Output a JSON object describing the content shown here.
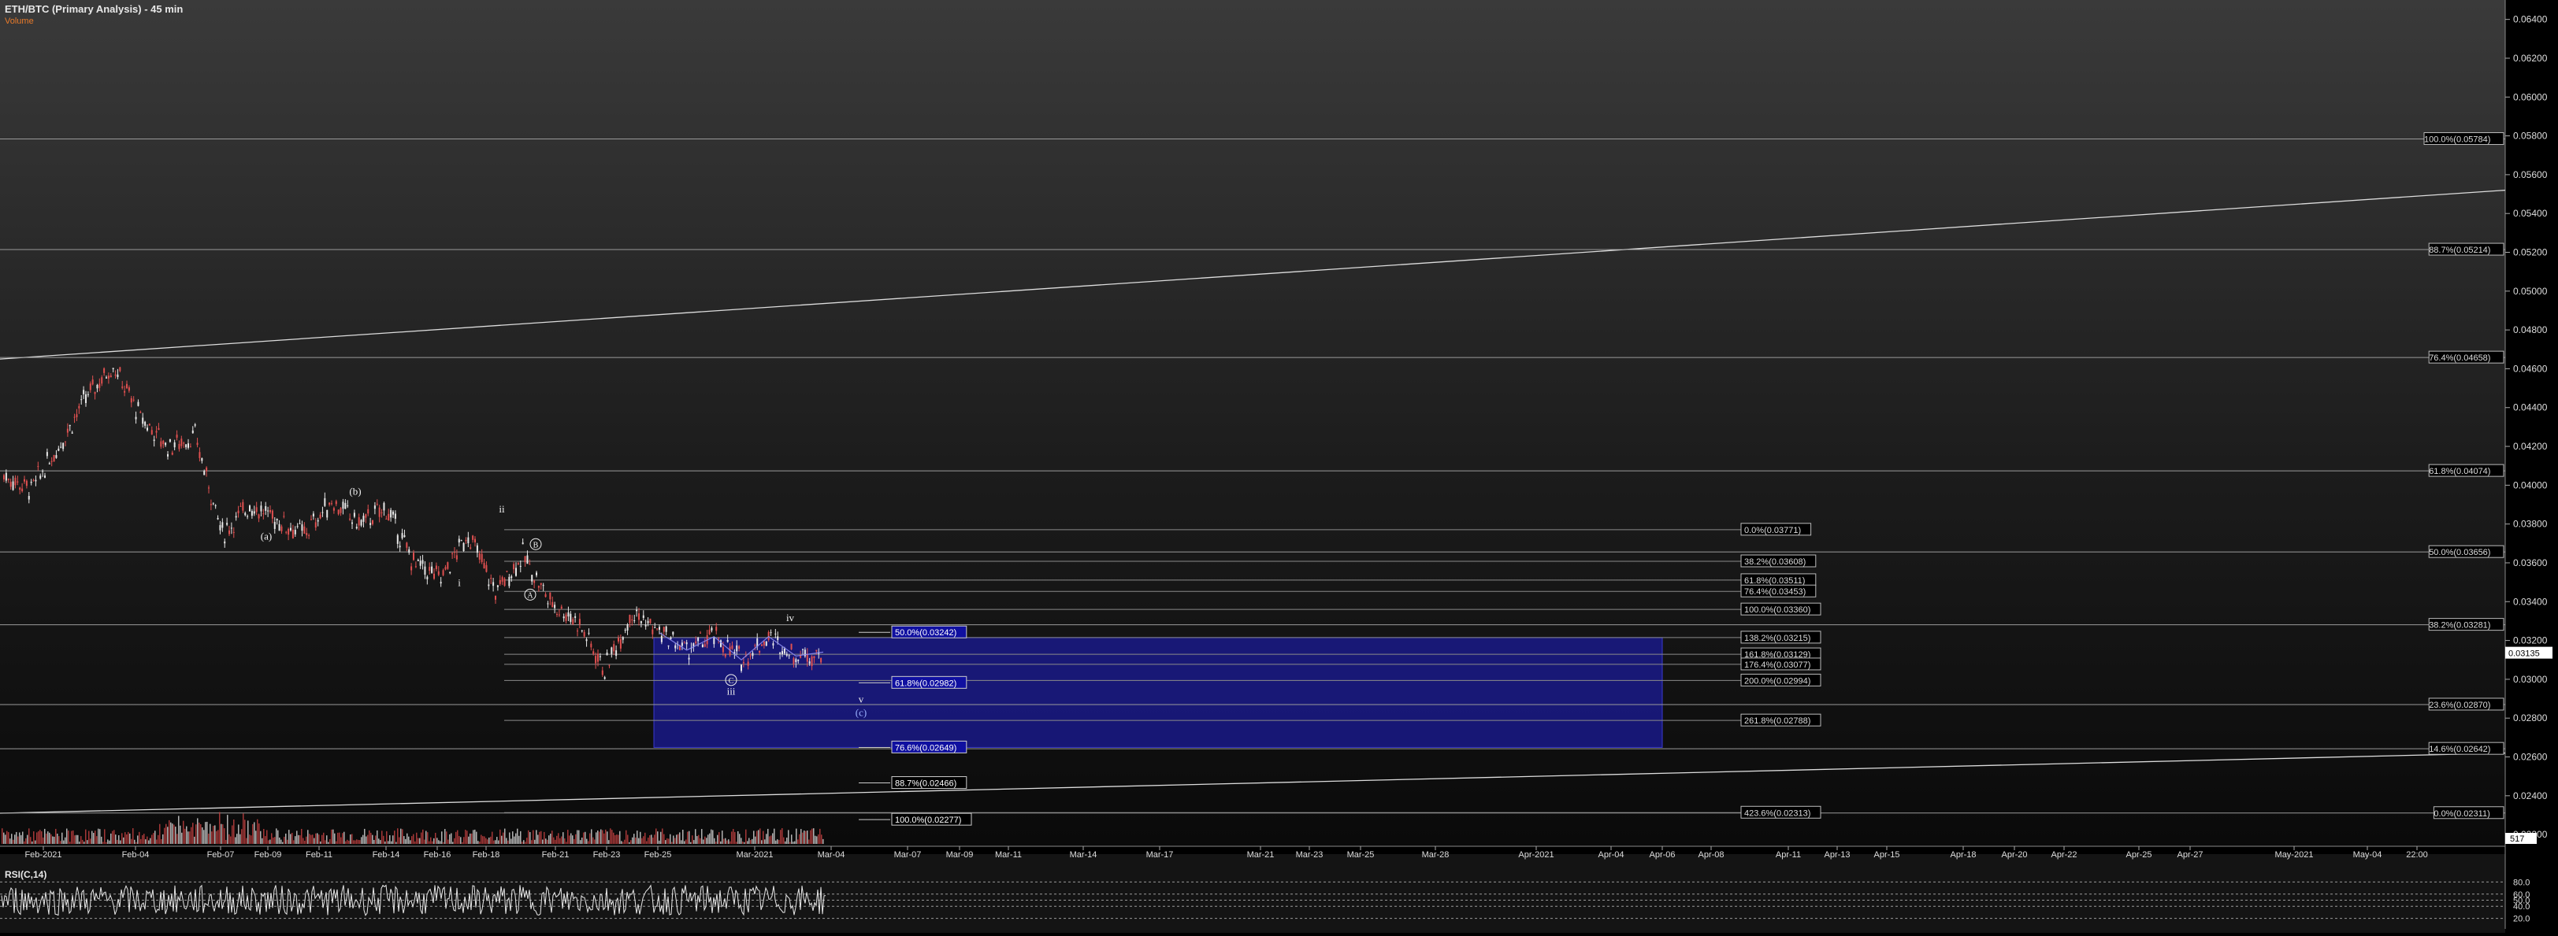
{
  "header": {
    "title": "ETH/BTC (Primary Analysis) - 45 min",
    "subtitle": "Volume"
  },
  "rsi": {
    "label": "RSI(C,14)",
    "ticks": [
      "80.0",
      "60.0",
      "50.0",
      "40.0",
      "20.0"
    ]
  },
  "volume_badge": "517",
  "price_badge": "0.03135",
  "colors": {
    "background": "#000000",
    "zone": "#1a1a8c",
    "up": "#e8e8e8",
    "down": "#e05050",
    "grid": "#ffffff"
  },
  "chart_data": {
    "type": "line",
    "title": "ETH/BTC (Primary Analysis) - 45 min",
    "y_ticks": [
      "0.02200",
      "0.02400",
      "0.02600",
      "0.02800",
      "0.03000",
      "0.03200",
      "0.03400",
      "0.03600",
      "0.03800",
      "0.04000",
      "0.04200",
      "0.04400",
      "0.04600",
      "0.04800",
      "0.05000",
      "0.05200",
      "0.05400",
      "0.05600",
      "0.05800",
      "0.06000",
      "0.06200",
      "0.06400"
    ],
    "ylim": [
      0.0216,
      0.065
    ],
    "x_ticks": [
      "Feb-2021",
      "Feb-04",
      "Feb-07",
      "Feb-09",
      "Feb-11",
      "Feb-14",
      "Feb-16",
      "Feb-18",
      "Feb-21",
      "Feb-23",
      "Feb-25",
      "Mar-2021",
      "Mar-04",
      "Mar-07",
      "Mar-09",
      "Mar-11",
      "Mar-14",
      "Mar-17",
      "Mar-21",
      "Mar-23",
      "Mar-25",
      "Mar-28",
      "Apr-2021",
      "Apr-04",
      "Apr-06",
      "Apr-08",
      "Apr-11",
      "Apr-13",
      "Apr-15",
      "Apr-18",
      "Apr-20",
      "Apr-22",
      "Apr-25",
      "Apr-27",
      "May-2021",
      "May-04",
      "22:00"
    ],
    "price_series": [
      [
        "Feb-2021",
        0.0405
      ],
      [
        "Feb-02",
        0.0398
      ],
      [
        "Feb-03",
        0.042
      ],
      [
        "Feb-04",
        0.0445
      ],
      [
        "Feb-05",
        0.0462
      ],
      [
        "Feb-06",
        0.0435
      ],
      [
        "Feb-07",
        0.042
      ],
      [
        "Feb-08",
        0.0425
      ],
      [
        "Feb-09",
        0.0375
      ],
      [
        "Feb-10",
        0.039
      ],
      [
        "Feb-11",
        0.0382
      ],
      [
        "Feb-12",
        0.0375
      ],
      [
        "Feb-13",
        0.0392
      ],
      [
        "Feb-14",
        0.038
      ],
      [
        "Feb-15",
        0.0388
      ],
      [
        "Feb-16",
        0.036
      ],
      [
        "Feb-17",
        0.0352
      ],
      [
        "Feb-18",
        0.0375
      ],
      [
        "Feb-19",
        0.0345
      ],
      [
        "Feb-20",
        0.0364
      ],
      [
        "Feb-21",
        0.034
      ],
      [
        "Feb-22",
        0.033
      ],
      [
        "Feb-23",
        0.0305
      ],
      [
        "Feb-24",
        0.0335
      ],
      [
        "Feb-25",
        0.0324
      ],
      [
        "Feb-26",
        0.0315
      ],
      [
        "Feb-27",
        0.0322
      ],
      [
        "Feb-28",
        0.031
      ],
      [
        "Mar-2021",
        0.0322
      ],
      [
        "Mar-02",
        0.0312
      ],
      [
        "Mar-03",
        0.0314
      ]
    ],
    "fib_levels_right": [
      "100.0%(0.05784)",
      "88.7%(0.05214)",
      "76.4%(0.04658)",
      "61.8%(0.04074)",
      "50.0%(0.03656)",
      "38.2%(0.03281)",
      "23.6%(0.02870)",
      "14.6%(0.02642)",
      "0.0%(0.02311)"
    ],
    "fib_levels_mid": [
      "0.0%(0.03771)",
      "38.2%(0.03608)",
      "61.8%(0.03511)",
      "76.4%(0.03453)",
      "100.0%(0.03360)",
      "138.2%(0.03215)",
      "161.8%(0.03129)",
      "176.4%(0.03077)",
      "200.0%(0.02994)",
      "261.8%(0.02788)",
      "423.6%(0.02313)"
    ],
    "fib_levels_zone": [
      "50.0%(0.03242)",
      "61.8%(0.02982)",
      "76.6%(0.02649)",
      "88.7%(0.02466)",
      "100.0%(0.02277)"
    ],
    "wave_labels": [
      "(a)",
      "(b)",
      "i",
      "ii",
      "iii",
      "iv",
      "v",
      "(c)",
      "A",
      "B",
      "C"
    ],
    "channel_lines": [
      {
        "from": [
          "Feb-2021",
          0.0465
        ],
        "to": [
          "22:00",
          0.0552
        ]
      },
      {
        "from": [
          "Feb-2021",
          0.0231
        ],
        "to": [
          "22:00",
          0.0262
        ]
      }
    ],
    "target_zone": {
      "x_from": "Feb-25",
      "x_to": "Apr-06",
      "y_from": 0.02649,
      "y_to": 0.03215
    }
  }
}
